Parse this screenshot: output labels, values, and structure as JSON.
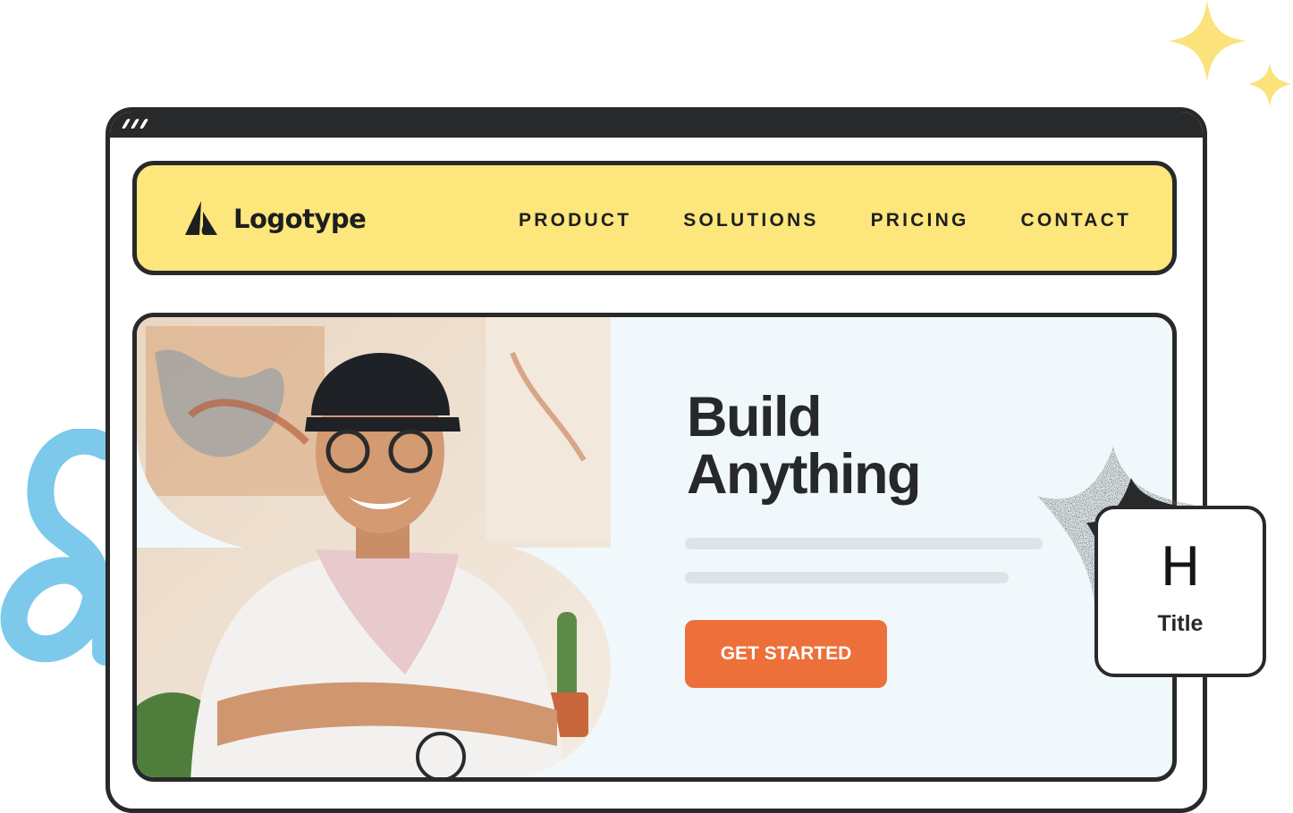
{
  "brand": {
    "name": "Logotype",
    "icon": "logo-mark-icon"
  },
  "nav": {
    "items": [
      {
        "label": "PRODUCT"
      },
      {
        "label": "SOLUTIONS"
      },
      {
        "label": "PRICING"
      },
      {
        "label": "CONTACT"
      }
    ]
  },
  "hero": {
    "headline_line1": "Build",
    "headline_line2": "Anything",
    "cta_label": "GET STARTED",
    "image": "portrait-photo"
  },
  "card": {
    "glyph": "H",
    "label": "Title"
  },
  "colors": {
    "nav_bg": "#fde67b",
    "hero_bg": "#f0f8fb",
    "cta": "#ed6f3a",
    "frame": "#28292b",
    "sparkle": "#fbe27a",
    "squiggle": "#7cc9ec"
  }
}
